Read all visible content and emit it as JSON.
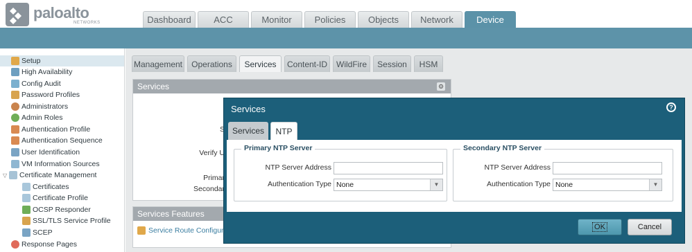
{
  "brand": {
    "name": "paloalto",
    "sub": "NETWORKS"
  },
  "main_tabs": [
    "Dashboard",
    "ACC",
    "Monitor",
    "Policies",
    "Objects",
    "Network",
    "Device"
  ],
  "active_main_tab": "Device",
  "sidebar": {
    "items": [
      {
        "label": "Setup",
        "icon": "setup-icon",
        "selected": true
      },
      {
        "label": "High Availability",
        "icon": "ha-icon"
      },
      {
        "label": "Config Audit",
        "icon": "audit-icon"
      },
      {
        "label": "Password Profiles",
        "icon": "password-icon"
      },
      {
        "label": "Administrators",
        "icon": "admin-icon"
      },
      {
        "label": "Admin Roles",
        "icon": "roles-icon"
      },
      {
        "label": "Authentication Profile",
        "icon": "auth-profile-icon"
      },
      {
        "label": "Authentication Sequence",
        "icon": "auth-sequence-icon"
      },
      {
        "label": "User Identification",
        "icon": "user-id-icon"
      },
      {
        "label": "VM Information Sources",
        "icon": "vm-icon"
      },
      {
        "label": "Certificate Management",
        "icon": "cert-mgmt-icon",
        "expanded": true
      },
      {
        "label": "Certificates",
        "icon": "certificate-icon",
        "child": true
      },
      {
        "label": "Certificate Profile",
        "icon": "cert-profile-icon",
        "child": true
      },
      {
        "label": "OCSP Responder",
        "icon": "ocsp-icon",
        "child": true
      },
      {
        "label": "SSL/TLS Service Profile",
        "icon": "lock-icon",
        "child": true
      },
      {
        "label": "SCEP",
        "icon": "scep-icon",
        "child": true
      },
      {
        "label": "Response Pages",
        "icon": "response-icon"
      }
    ]
  },
  "sub_tabs": [
    "Management",
    "Operations",
    "Services",
    "Content-ID",
    "WildFire",
    "Session",
    "HSM"
  ],
  "active_sub_tab": "Services",
  "services_panel": {
    "title": "Services",
    "partial_labels": [
      "S",
      "Verify U",
      "Primar",
      "Secondar"
    ]
  },
  "services_features_panel": {
    "title": "Services Features",
    "link": "Service Route Configurat"
  },
  "modal": {
    "title": "Services",
    "tabs": [
      "Services",
      "NTP"
    ],
    "active_tab": "NTP",
    "primary": {
      "legend": "Primary NTP Server",
      "address_label": "NTP Server Address",
      "address_value": "",
      "auth_label": "Authentication Type",
      "auth_value": "None"
    },
    "secondary": {
      "legend": "Secondary NTP Server",
      "address_label": "NTP Server Address",
      "address_value": "",
      "auth_label": "Authentication Type",
      "auth_value": "None"
    },
    "ok_label": "OK",
    "cancel_label": "Cancel"
  }
}
